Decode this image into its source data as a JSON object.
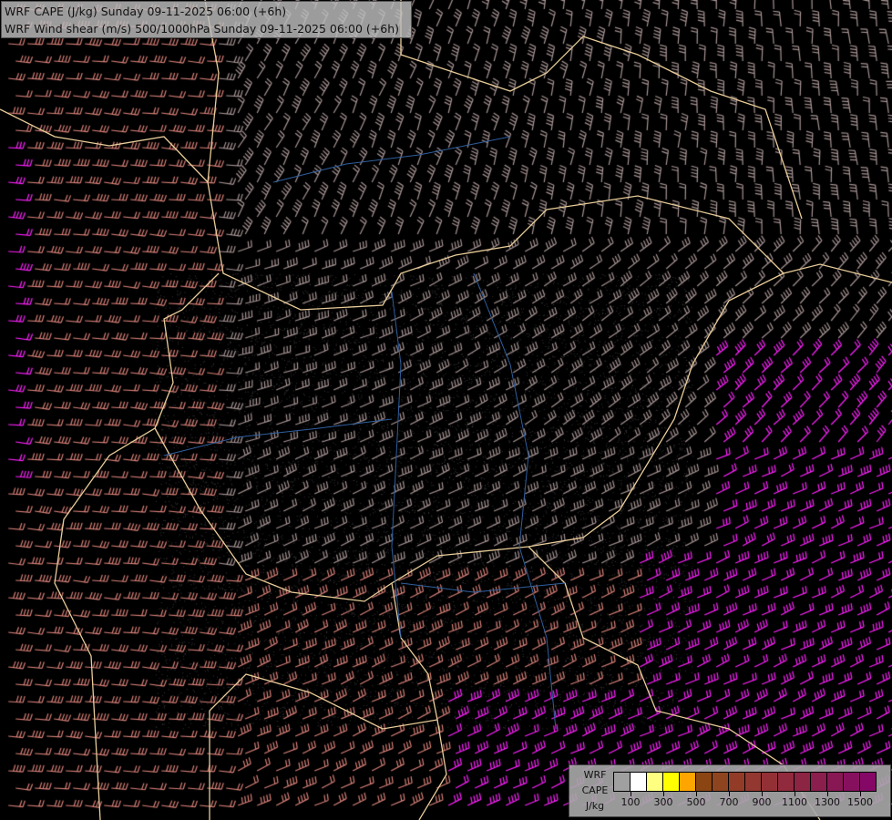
{
  "title": {
    "line1": "WRF CAPE (J/kg) Sunday 09-11-2025 06:00 (+6h)",
    "line2": "WRF Wind shear (m/s) 500/1000hPa Sunday 09-11-2025 06:00 (+6h)"
  },
  "legend": {
    "label_lines": [
      "WRF",
      "CAPE",
      "J/kg"
    ],
    "colors": [
      "#a0a0a0",
      "#ffffff",
      "#ffff80",
      "#ffff00",
      "#ffa500",
      "#8b4513",
      "#8f4420",
      "#923c28",
      "#933830",
      "#933035",
      "#902a3c",
      "#8c2444",
      "#8a1e4c",
      "#881854",
      "#86105e",
      "#850866"
    ],
    "ticks": [
      "100",
      "300",
      "500",
      "700",
      "900",
      "1100",
      "1300",
      "1500"
    ]
  },
  "colors": {
    "border": "#e8cc98",
    "river": "#2f5f9f",
    "barb_salmon": "#d88078",
    "barb_gray": "#a89494",
    "barb_magenta": "#ff22ff"
  }
}
